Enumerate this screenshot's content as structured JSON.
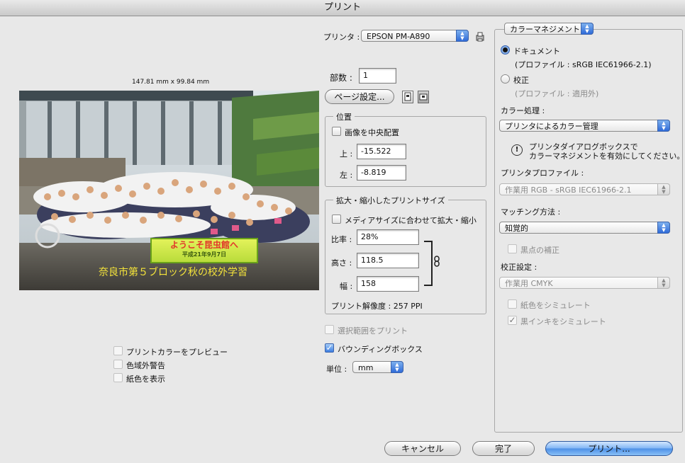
{
  "window": {
    "title": "プリント"
  },
  "preview": {
    "dimensions": "147.81 mm x 99.84 mm",
    "photo_caption": "奈良市第５ブロック秋の校外学習",
    "sign_text": "ようこそ昆虫館へ",
    "sign_subtext": "平成21年9月7日",
    "options": [
      {
        "label": "プリントカラーをプレビュー",
        "checked": false
      },
      {
        "label": "色域外警告",
        "checked": false
      },
      {
        "label": "紙色を表示",
        "checked": false
      }
    ]
  },
  "printer": {
    "label": "プリンタ :",
    "value": "EPSON PM-A890"
  },
  "copies": {
    "label": "部数 :",
    "value": "1"
  },
  "page_setup_button": "ページ設定...",
  "position": {
    "title": "位置",
    "center_label": "画像を中央配置",
    "top_label": "上 :",
    "top_value": "-15.522",
    "left_label": "左 :",
    "left_value": "-8.819"
  },
  "scaled_size": {
    "title": "拡大・縮小したプリントサイズ",
    "fit_media_label": "メディアサイズに合わせて拡大・縮小",
    "scale_label": "比率 :",
    "scale_value": "28%",
    "height_label": "高さ :",
    "height_value": "118.5",
    "width_label": "幅 :",
    "width_value": "158",
    "resolution": "プリント解像度 : 257 PPI"
  },
  "print_selected_label": "選択範囲をプリント",
  "bounding_box_label": "バウンディングボックス",
  "units": {
    "label": "単位 :",
    "value": "mm"
  },
  "color_management": {
    "mode": "カラーマネジメント",
    "document_label": "ドキュメント",
    "document_profile": "(プロファイル : sRGB IEC61966-2.1)",
    "proof_label": "校正",
    "proof_profile": "(プロファイル : 適用外)",
    "color_handling_label": "カラー処理 :",
    "color_handling_value": "プリンタによるカラー管理",
    "notice_line1": "プリンタダイアログボックスで",
    "notice_line2": "カラーマネジメントを有効にしてください。",
    "printer_profile_label": "プリンタプロファイル :",
    "printer_profile_value": "作業用 RGB - sRGB IEC61966-2.1",
    "matching_label": "マッチング方法 :",
    "matching_value": "知覚的",
    "black_point_label": "黒点の補正",
    "proof_setup_label": "校正設定 :",
    "proof_setup_value": "作業用 CMYK",
    "simulate_paper_label": "紙色をシミュレート",
    "simulate_ink_label": "黒インキをシミュレート"
  },
  "buttons": {
    "cancel": "キャンセル",
    "done": "完了",
    "print": "プリント..."
  }
}
